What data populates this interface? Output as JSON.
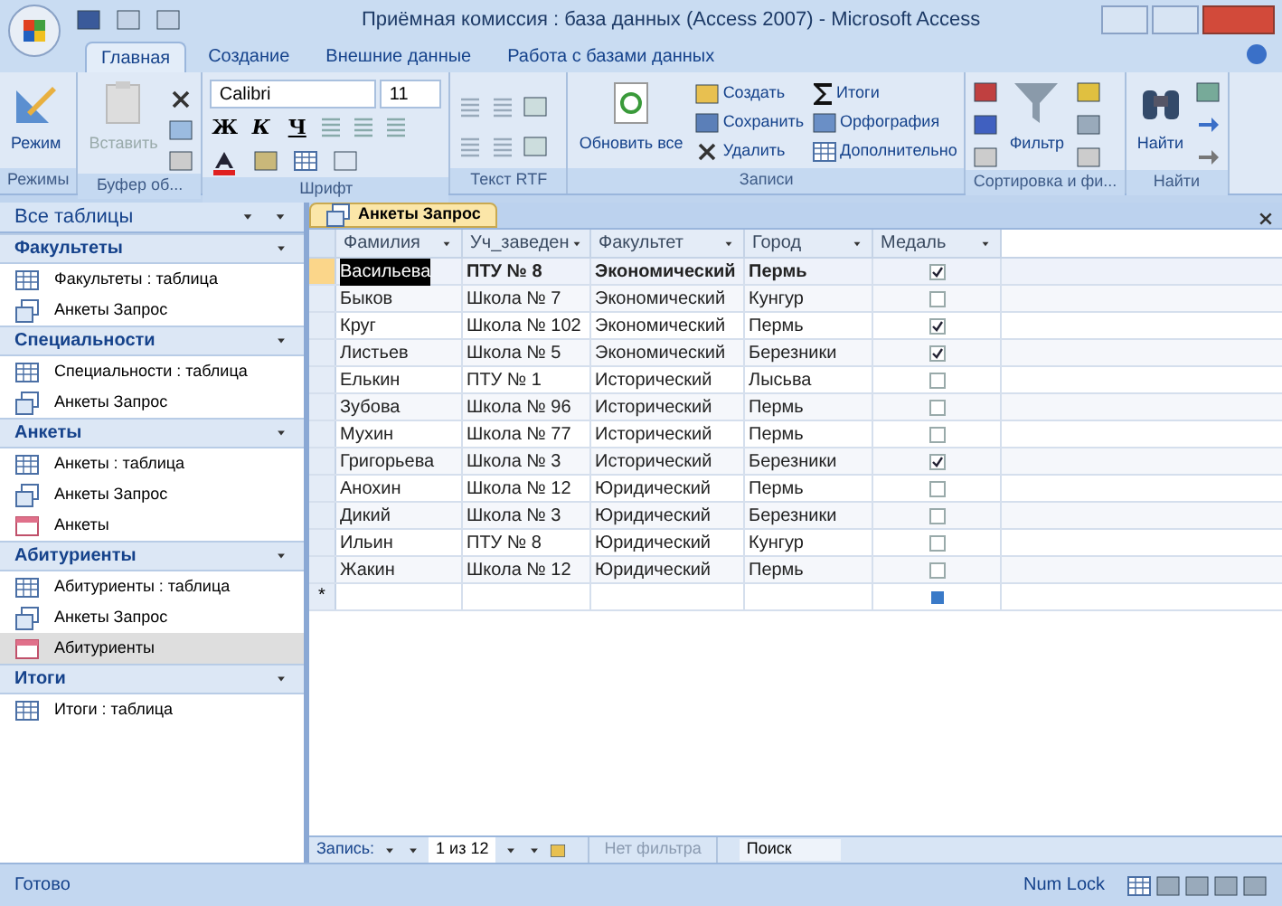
{
  "window": {
    "title": "Приёмная комиссия : база данных (Access 2007) - Microsoft Access"
  },
  "ribbon_tabs": [
    {
      "label": "Главная",
      "selected": true
    },
    {
      "label": "Создание",
      "selected": false
    },
    {
      "label": "Внешние данные",
      "selected": false
    },
    {
      "label": "Работа с базами данных",
      "selected": false
    }
  ],
  "ribbon_groups": [
    {
      "kind": "modes",
      "label": "Режимы",
      "buttons": [
        {
          "label": "Режим",
          "disabled": false
        }
      ]
    },
    {
      "kind": "clipboard",
      "label": "Буфер об...",
      "buttons": [
        {
          "label": "Вставить",
          "disabled": true
        }
      ]
    },
    {
      "kind": "font",
      "label": "Шрифт",
      "font_name": "Calibri",
      "font_size": "11",
      "buttons": [
        {
          "label": "Ж"
        },
        {
          "label": "К"
        },
        {
          "label": "Ч"
        }
      ]
    },
    {
      "kind": "rtf",
      "label": "Текст RTF"
    },
    {
      "kind": "records",
      "label": "Записи",
      "buttons": [
        {
          "label": "Обновить все"
        },
        {
          "label": "Создать"
        },
        {
          "label": "Сохранить"
        },
        {
          "label": "Удалить"
        },
        {
          "label": "Итоги"
        },
        {
          "label": "Орфография"
        },
        {
          "label": "Дополнительно"
        }
      ]
    },
    {
      "kind": "sort",
      "label": "Сортировка и фи...",
      "buttons": [
        {
          "label": "Фильтр"
        }
      ]
    },
    {
      "kind": "find",
      "label": "Найти",
      "buttons": [
        {
          "label": "Найти"
        }
      ]
    }
  ],
  "nav_pane": {
    "title": "Все таблицы",
    "sections": [
      {
        "title": "Факультеты",
        "items": [
          {
            "kind": "table",
            "label": "Факультеты : таблица",
            "selected": false
          },
          {
            "kind": "query",
            "label": "Анкеты Запрос",
            "selected": false
          }
        ]
      },
      {
        "title": "Специальности",
        "items": [
          {
            "kind": "table",
            "label": "Специальности : таблица",
            "selected": false
          },
          {
            "kind": "query",
            "label": "Анкеты Запрос",
            "selected": false
          }
        ]
      },
      {
        "title": "Анкеты",
        "items": [
          {
            "kind": "table",
            "label": "Анкеты : таблица",
            "selected": false
          },
          {
            "kind": "query",
            "label": "Анкеты Запрос",
            "selected": false
          },
          {
            "kind": "form",
            "label": "Анкеты",
            "selected": false
          }
        ]
      },
      {
        "title": "Абитуриенты",
        "items": [
          {
            "kind": "table",
            "label": "Абитуриенты : таблица",
            "selected": false
          },
          {
            "kind": "query",
            "label": "Анкеты Запрос",
            "selected": false
          },
          {
            "kind": "form",
            "label": "Абитуриенты",
            "selected": true
          }
        ]
      },
      {
        "title": "Итоги",
        "items": [
          {
            "kind": "table",
            "label": "Итоги : таблица",
            "selected": false
          }
        ]
      }
    ]
  },
  "document_tab": {
    "label": "Анкеты Запрос"
  },
  "table": {
    "columns": [
      "Фамилия",
      "Уч_заведен",
      "Факультет",
      "Город",
      "Медаль"
    ],
    "rows": [
      {
        "selected": true,
        "cells": [
          "Васильева",
          "ПТУ № 8",
          "Экономический",
          "Пермь"
        ],
        "medal": true
      },
      {
        "selected": false,
        "cells": [
          "Быков",
          "Школа № 7",
          "Экономический",
          "Кунгур"
        ],
        "medal": false
      },
      {
        "selected": false,
        "cells": [
          "Круг",
          "Школа № 102",
          "Экономический",
          "Пермь"
        ],
        "medal": true
      },
      {
        "selected": false,
        "cells": [
          "Листьев",
          "Школа № 5",
          "Экономический",
          "Березники"
        ],
        "medal": true
      },
      {
        "selected": false,
        "cells": [
          "Елькин",
          "ПТУ № 1",
          "Исторический",
          "Лысьва"
        ],
        "medal": false
      },
      {
        "selected": false,
        "cells": [
          "Зубова",
          "Школа № 96",
          "Исторический",
          "Пермь"
        ],
        "medal": false
      },
      {
        "selected": false,
        "cells": [
          "Мухин",
          "Школа № 77",
          "Исторический",
          "Пермь"
        ],
        "medal": false
      },
      {
        "selected": false,
        "cells": [
          "Григорьева",
          "Школа № 3",
          "Исторический",
          "Березники"
        ],
        "medal": true
      },
      {
        "selected": false,
        "cells": [
          "Анохин",
          "Школа № 12",
          "Юридический",
          "Пермь"
        ],
        "medal": false
      },
      {
        "selected": false,
        "cells": [
          "Дикий",
          "Школа № 3",
          "Юридический",
          "Березники"
        ],
        "medal": false
      },
      {
        "selected": false,
        "cells": [
          "Ильин",
          "ПТУ № 8",
          "Юридический",
          "Кунгур"
        ],
        "medal": false
      },
      {
        "selected": false,
        "cells": [
          "Жакин",
          "Школа № 12",
          "Юридический",
          "Пермь"
        ],
        "medal": false
      }
    ],
    "new_row_marker": "*"
  },
  "record_nav": {
    "label": "Запись:",
    "position": "1 из 12",
    "filter": "Нет фильтра",
    "search_placeholder": "Поиск"
  },
  "status_bar": {
    "left": "Готово",
    "right": "Num Lock"
  }
}
